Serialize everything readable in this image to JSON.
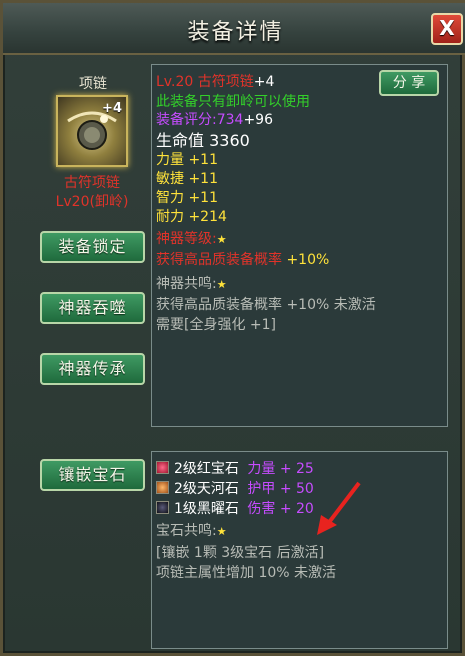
{
  "window": {
    "title": "装备详情",
    "close_label": "X"
  },
  "item": {
    "slot": "项链",
    "enhance": "+4",
    "name": "古符项链",
    "level_tag": "Lv20(卸岭)"
  },
  "buttons": {
    "lock": "装备锁定",
    "devour": "神器吞噬",
    "inherit": "神器传承",
    "inlay": "镶嵌宝石",
    "share": "分 享"
  },
  "details": {
    "title_level": "Lv.20 古符项链",
    "title_plus": "+4",
    "restriction": "此装备只有卸岭可以使用",
    "score_label": "装备评分:",
    "score_value": "734",
    "score_bonus": "+96",
    "hp_label": "生命值",
    "hp_value": "3360",
    "stats": [
      {
        "label": "力量",
        "value": "+11"
      },
      {
        "label": "敏捷",
        "value": "+11"
      },
      {
        "label": "智力",
        "value": "+11"
      },
      {
        "label": "耐力",
        "value": "+214"
      }
    ],
    "artifact_level": "神器等级:",
    "artifact_bonus_text": "获得高品质装备概率",
    "artifact_bonus_value": "+10%",
    "resonance_label": "神器共鸣:",
    "resonance_effect": "获得高品质装备概率 +10% 未激活",
    "resonance_req": "需要[全身强化 +1]"
  },
  "gems": {
    "list": [
      {
        "name": "2级红宝石",
        "stat": "力量 + 25"
      },
      {
        "name": "2级天河石",
        "stat": "护甲 + 50"
      },
      {
        "name": "1级黑曜石",
        "stat": "伤害 + 20"
      }
    ],
    "resonance_label": "宝石共鸣:",
    "resonance_req": "[镶嵌 1颗 3级宝石 后激活]",
    "resonance_effect": "项链主属性增加 10% 未激活"
  },
  "colors": {
    "red": "#e0332a",
    "green": "#33d02a",
    "yellow": "#ffe23a",
    "purple": "#c64cff",
    "white": "#ffffff",
    "grey": "#b8bcb6"
  },
  "icons": {
    "star": "star-icon",
    "arrow": "annotation-arrow"
  }
}
